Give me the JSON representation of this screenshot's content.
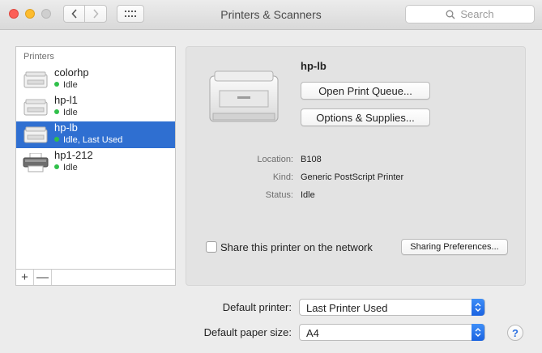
{
  "window": {
    "title": "Printers & Scanners",
    "search_placeholder": "Search",
    "back_glyph": "‹",
    "forward_glyph": "›"
  },
  "list": {
    "header": "Printers",
    "items": [
      {
        "name": "colorhp",
        "status": "Idle",
        "icon": "laser-printer-icon",
        "selected": false
      },
      {
        "name": "hp-l1",
        "status": "Idle",
        "icon": "laser-printer-icon",
        "selected": false
      },
      {
        "name": "hp-lb",
        "status": "Idle, Last Used",
        "icon": "laser-printer-icon",
        "selected": true
      },
      {
        "name": "hp1-212",
        "status": "Idle",
        "icon": "inkjet-printer-icon",
        "selected": false
      }
    ],
    "add_label": "+",
    "remove_label": "—"
  },
  "detail": {
    "name": "hp-lb",
    "open_queue_label": "Open Print Queue...",
    "options_label": "Options & Supplies...",
    "location_label": "Location:",
    "location_value": "B108",
    "kind_label": "Kind:",
    "kind_value": "Generic PostScript Printer",
    "status_label": "Status:",
    "status_value": "Idle",
    "share_label": "Share this printer on the network",
    "share_checked": false,
    "sharing_prefs_label": "Sharing Preferences..."
  },
  "defaults": {
    "printer_label": "Default printer:",
    "printer_value": "Last Printer Used",
    "paper_label": "Default paper size:",
    "paper_value": "A4"
  },
  "help_label": "?",
  "colors": {
    "selection": "#2f6fd1",
    "status_dot": "#30c04a",
    "popup_arrow": "#1a63e1"
  }
}
